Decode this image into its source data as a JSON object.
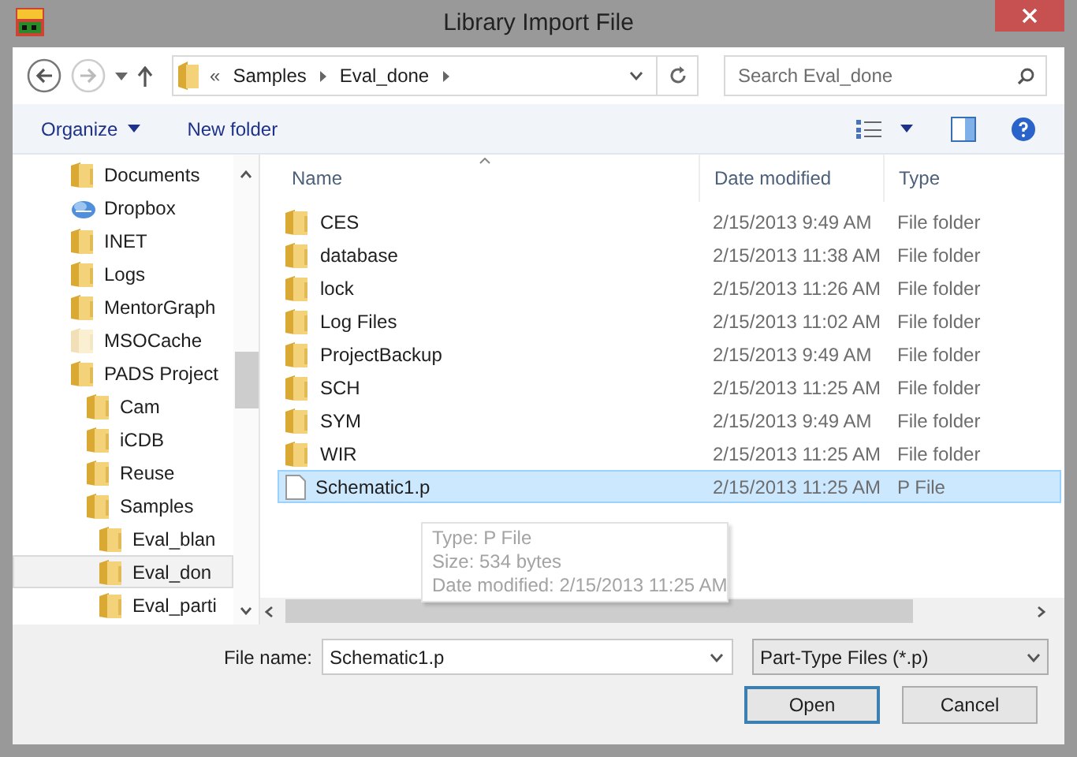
{
  "window": {
    "title": "Library Import File"
  },
  "address": {
    "overflow": "«",
    "crumbs": [
      "Samples",
      "Eval_done"
    ]
  },
  "search": {
    "placeholder": "Search Eval_done"
  },
  "toolbar": {
    "organize": "Organize",
    "new_folder": "New folder"
  },
  "tree": [
    {
      "label": "Documents",
      "kind": "folder",
      "hidden": false,
      "selected": false
    },
    {
      "label": "Dropbox",
      "kind": "dropbox",
      "hidden": false,
      "selected": false
    },
    {
      "label": "INET",
      "kind": "folder",
      "hidden": false,
      "selected": false
    },
    {
      "label": "Logs",
      "kind": "folder",
      "hidden": false,
      "selected": false
    },
    {
      "label": "MentorGraph",
      "kind": "folder",
      "hidden": false,
      "selected": false
    },
    {
      "label": "MSOCache",
      "kind": "folder",
      "hidden": true,
      "selected": false
    },
    {
      "label": "PADS Project",
      "kind": "folder",
      "hidden": false,
      "selected": false,
      "children": [
        {
          "label": "Cam",
          "kind": "folder",
          "hidden": false,
          "selected": false
        },
        {
          "label": "iCDB",
          "kind": "folder",
          "hidden": false,
          "selected": false
        },
        {
          "label": "Reuse",
          "kind": "folder",
          "hidden": false,
          "selected": false
        },
        {
          "label": "Samples",
          "kind": "folder",
          "hidden": false,
          "selected": false,
          "children": [
            {
              "label": "Eval_blan",
              "kind": "folder",
              "hidden": false,
              "selected": false
            },
            {
              "label": "Eval_don",
              "kind": "folder",
              "hidden": false,
              "selected": true
            },
            {
              "label": "Eval_parti",
              "kind": "folder",
              "hidden": false,
              "selected": false
            }
          ]
        }
      ]
    }
  ],
  "columns": [
    "Name",
    "Date modified",
    "Type"
  ],
  "files": [
    {
      "name": "CES",
      "date": "2/15/2013 9:49 AM",
      "type": "File folder",
      "kind": "folder",
      "selected": false
    },
    {
      "name": "database",
      "date": "2/15/2013 11:38 AM",
      "type": "File folder",
      "kind": "folder",
      "selected": false
    },
    {
      "name": "lock",
      "date": "2/15/2013 11:26 AM",
      "type": "File folder",
      "kind": "folder",
      "selected": false
    },
    {
      "name": "Log Files",
      "date": "2/15/2013 11:02 AM",
      "type": "File folder",
      "kind": "folder",
      "selected": false
    },
    {
      "name": "ProjectBackup",
      "date": "2/15/2013 9:49 AM",
      "type": "File folder",
      "kind": "folder",
      "selected": false
    },
    {
      "name": "SCH",
      "date": "2/15/2013 11:25 AM",
      "type": "File folder",
      "kind": "folder",
      "selected": false
    },
    {
      "name": "SYM",
      "date": "2/15/2013 9:49 AM",
      "type": "File folder",
      "kind": "folder",
      "selected": false
    },
    {
      "name": "WIR",
      "date": "2/15/2013 11:25 AM",
      "type": "File folder",
      "kind": "folder",
      "selected": false
    },
    {
      "name": "Schematic1.p",
      "date": "2/15/2013 11:25 AM",
      "type": "P File",
      "kind": "file",
      "selected": true
    }
  ],
  "tooltip": [
    "Type: P File",
    "Size: 534 bytes",
    "Date modified: 2/15/2013 11:25 AM"
  ],
  "file_name": {
    "label": "File name:",
    "value": "Schematic1.p"
  },
  "file_type": {
    "value": "Part-Type Files (*.p)"
  },
  "buttons": [
    "Open",
    "Cancel"
  ]
}
